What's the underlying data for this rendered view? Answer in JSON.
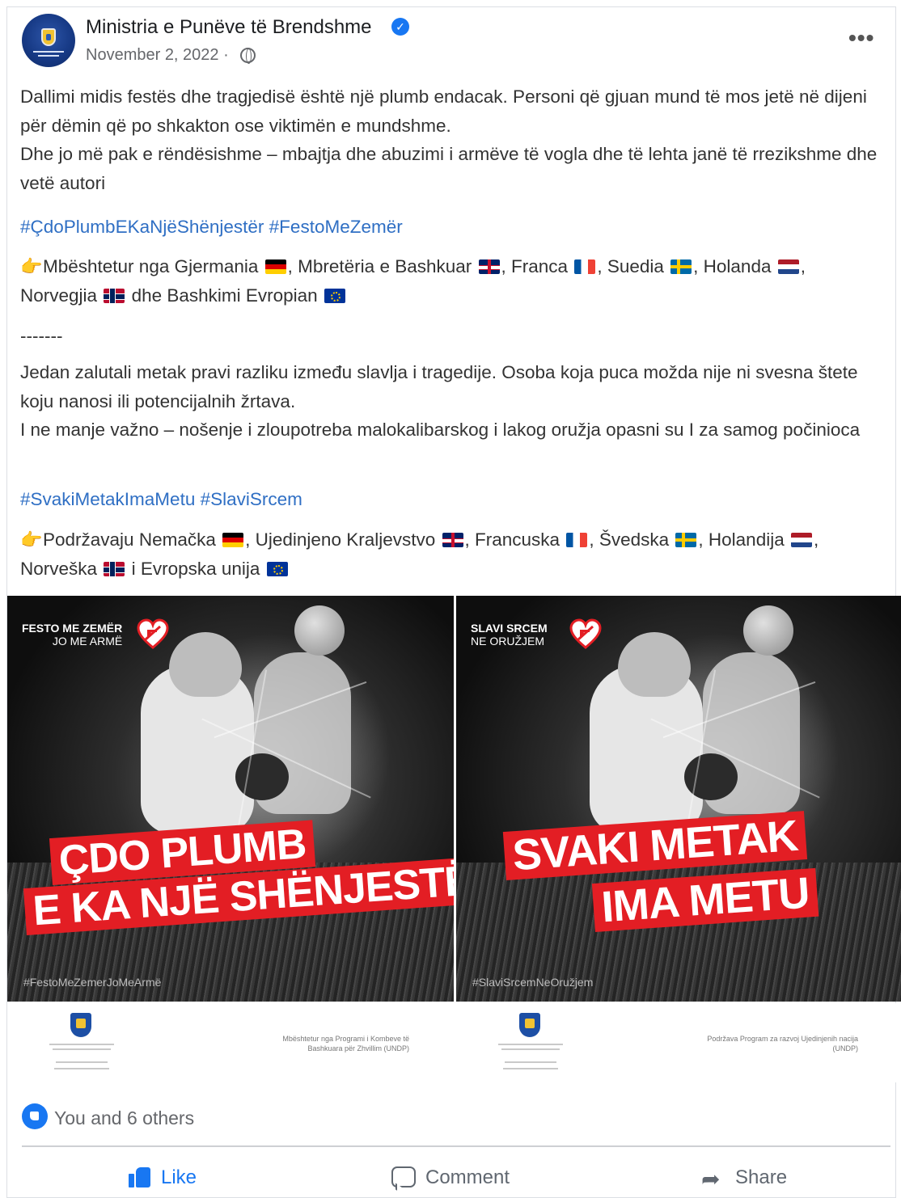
{
  "header": {
    "page_name": "Ministria e Punëve të Brendshme",
    "verified_icon": "verified-check-icon",
    "date": "November 2, 2022 ·",
    "privacy_icon": "globe-icon",
    "more_label": "•••"
  },
  "post": {
    "albanian": {
      "paragraph": "Dallimi midis festës dhe tragjedisë është një plumb endacak. Personi që gjuan mund të mos jetë në dijeni për dëmin që po shkakton ose viktimën e mundshme.",
      "paragraph2": "Dhe jo më pak e rëndësishme – mbajtja dhe abuzimi i armëve të vogla dhe të lehta janë të rrezikshme dhe vetë autori",
      "hashtags": "#ÇdoPlumbEKaNjëShënjestër #FestoMeZemër",
      "support_prefix": "Mbështetur nga Gjermania",
      "support_uk": ", Mbretëria e Bashkuar",
      "support_fr": ", Franca",
      "support_se": ", Suedia",
      "support_nl": ", Holanda",
      "support_no": ",",
      "support_no2": "Norvegjia",
      "support_eu": "dhe Bashkimi Evropian"
    },
    "separator": "-------",
    "serbian": {
      "paragraph": "Jedan zalutali metak pravi razliku između slavlja i tragedije. Osoba koja puca možda nije ni svesna štete koju nanosi ili potencijalnih žrtava.",
      "paragraph2": "I ne manje važno – nošenje i zloupotreba malokalibarskog i lakog oružja opasni su I za samog počinioca",
      "hashtags": "#SvakiMetakImaMetu #SlaviSrcem",
      "support_prefix": "Podržavaju Nemačka",
      "support_uk": ", Ujedinjeno Kraljevstvo",
      "support_fr": ", Francuska",
      "support_se": ", Švedska",
      "support_nl": ", Holandija",
      "support_no": ",",
      "support_no2": "Norveška",
      "support_eu": "i Evropska unija"
    }
  },
  "images": [
    {
      "brand_line1": "FESTO ME ZEMËR",
      "brand_line2": "JO ME ARMË",
      "banner_line1": "ÇDO PLUMB",
      "banner_line2": "E KA NJË SHËNJESTËR",
      "tag": "#FestoMeZemerJoMeArmë",
      "footer_right": "Mbështetur nga Programi i Kombeve të Bashkuara për Zhvillim (UNDP)"
    },
    {
      "brand_line1": "SLAVI SRCEM",
      "brand_line2": "NE ORUŽJEM",
      "banner_line1": "SVAKI METAK",
      "banner_line2": "IMA METU",
      "tag": "#SlaviSrcemNeOružjem",
      "footer_right": "Podržava Program za razvoj Ujedinjenih nacija (UNDP)"
    }
  ],
  "reactions": {
    "text": "You and 6 others",
    "icon": "like-reaction-icon"
  },
  "actions": {
    "like": "Like",
    "comment": "Comment",
    "share": "Share"
  },
  "colors": {
    "accent": "#1877f2",
    "hashtag": "#2f6fc4",
    "banner_red": "#e31e24"
  }
}
